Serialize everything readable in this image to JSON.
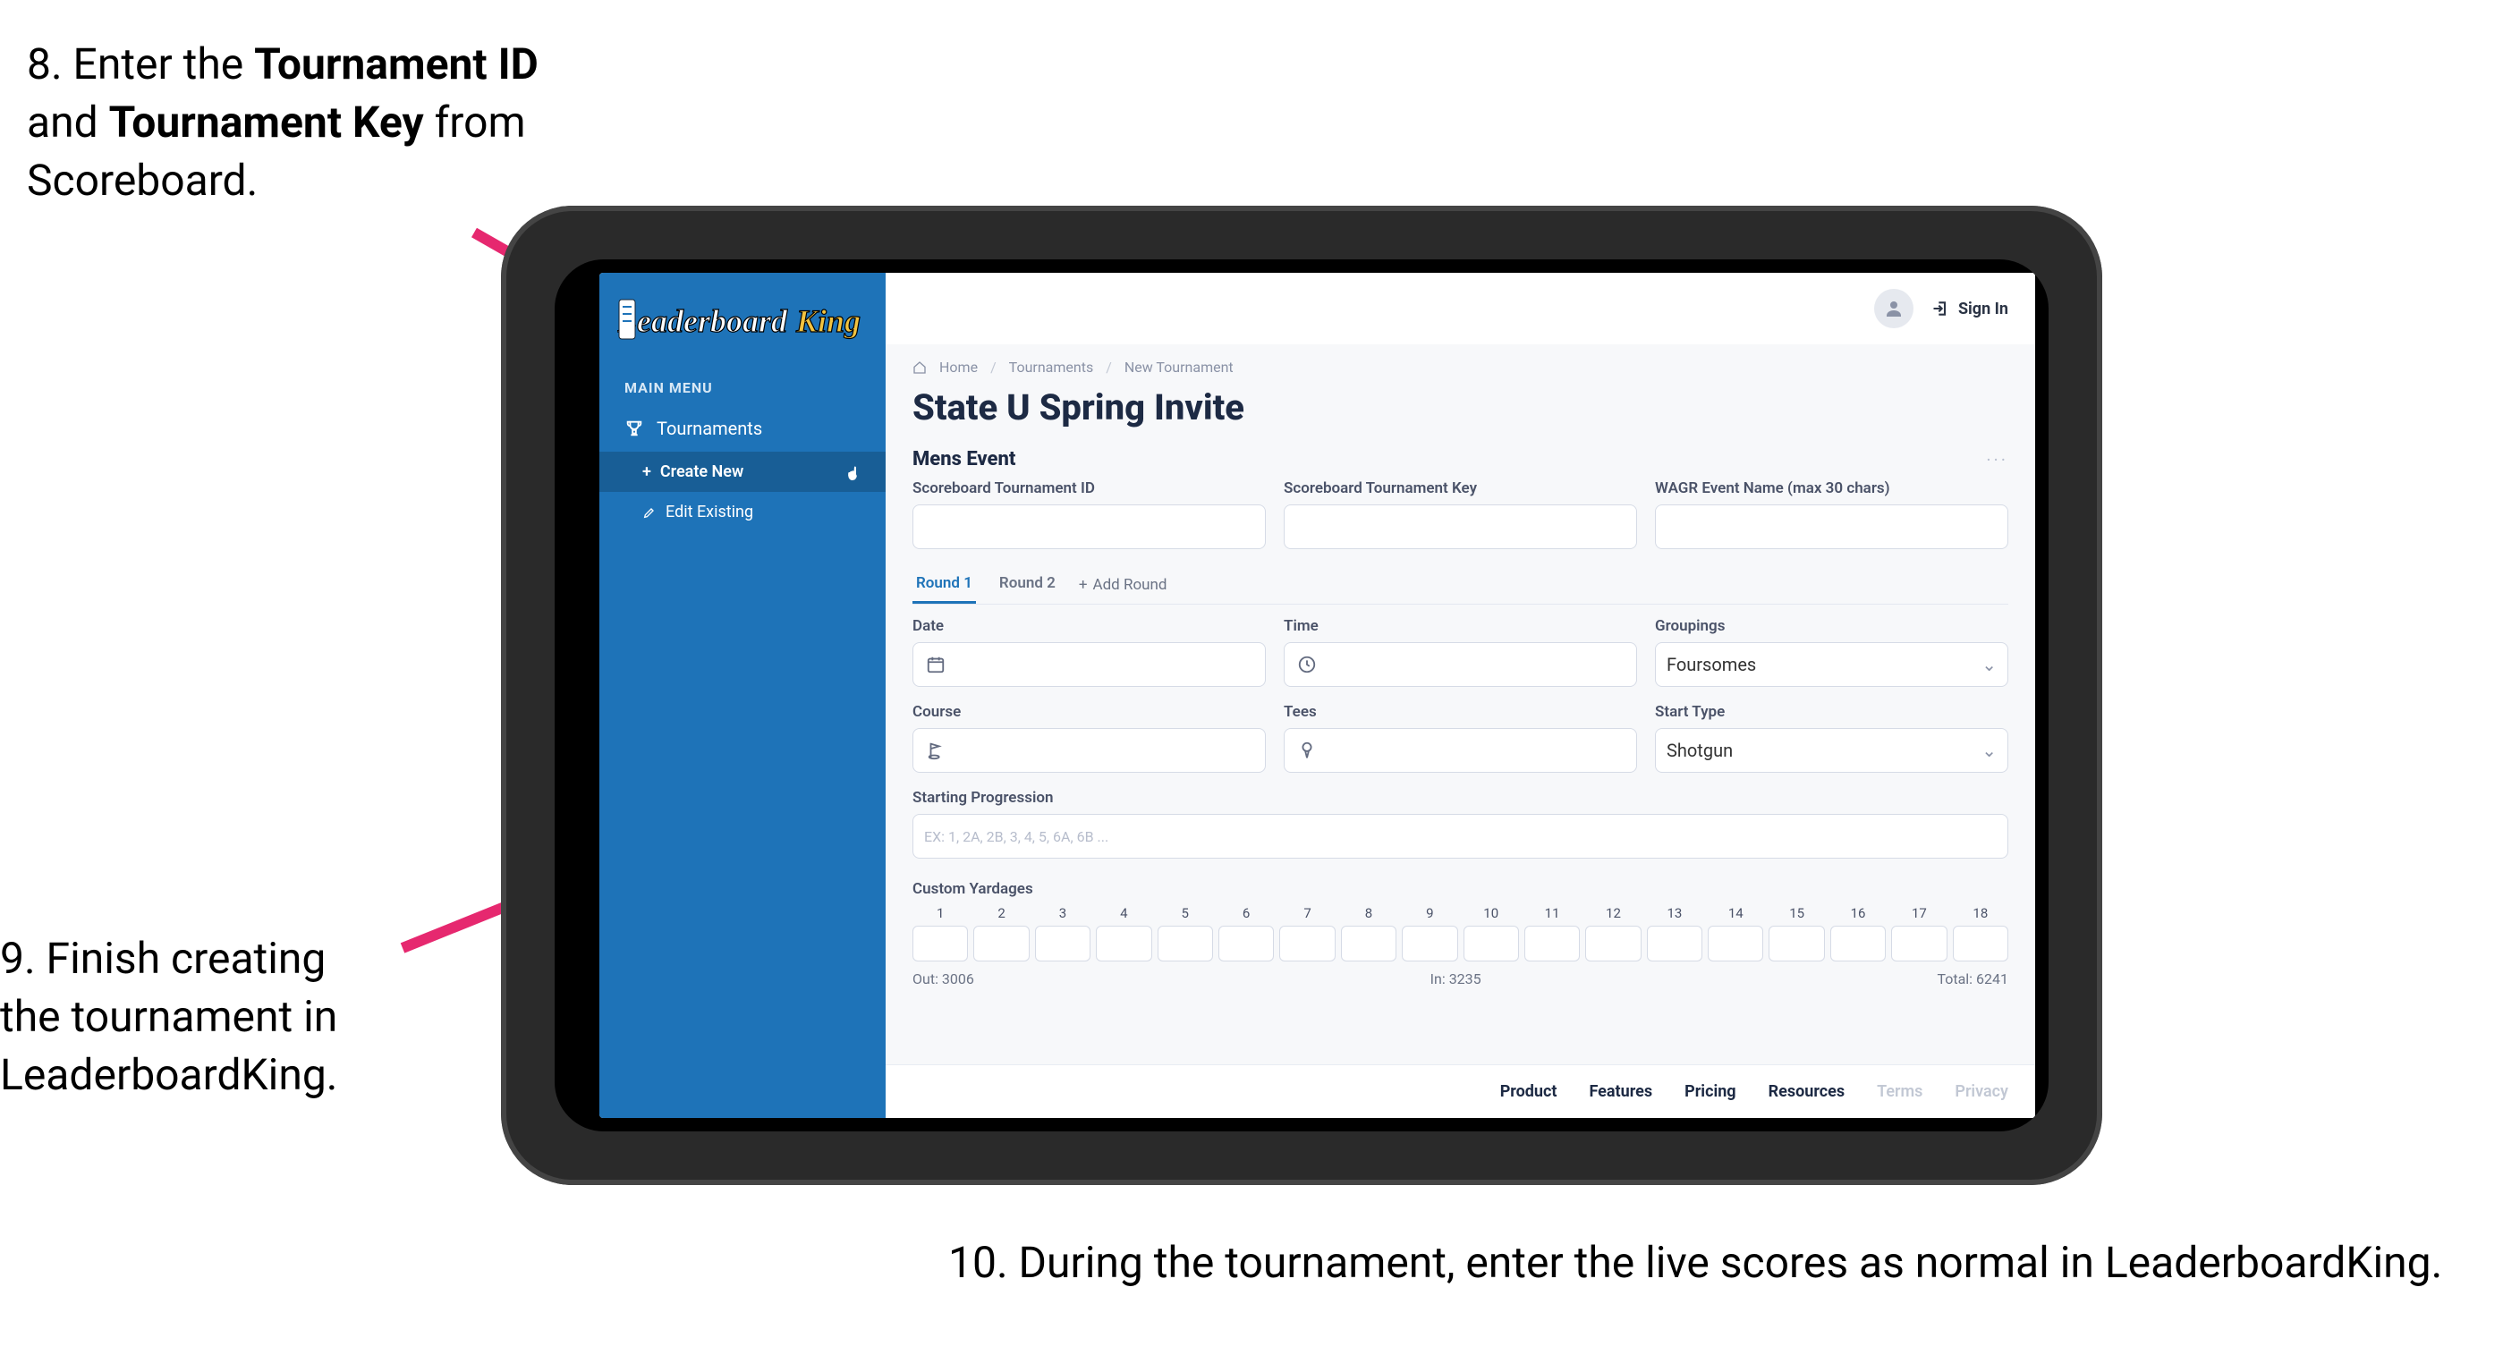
{
  "annotations": {
    "step8_pre": "8. Enter the ",
    "step8_b1": "Tournament ID",
    "step8_mid": " and ",
    "step8_b2": "Tournament Key",
    "step8_post": " from Scoreboard.",
    "step9": "9. Finish creating the tournament in LeaderboardKing.",
    "step10": "10. During the tournament, enter the live scores as normal in LeaderboardKing."
  },
  "sidebar": {
    "brand": "LeaderboardKing",
    "main_menu_label": "MAIN MENU",
    "nav_tournaments": "Tournaments",
    "nav_create_new": "Create New",
    "nav_edit_existing": "Edit Existing"
  },
  "topbar": {
    "signin": "Sign In"
  },
  "breadcrumb": {
    "home": "Home",
    "tournaments": "Tournaments",
    "current": "New Tournament"
  },
  "page_title": "State U Spring Invite",
  "section_title": "Mens Event",
  "fields": {
    "scoreboard_id_label": "Scoreboard Tournament ID",
    "scoreboard_key_label": "Scoreboard Tournament Key",
    "wagr_label": "WAGR Event Name (max 30 chars)",
    "date_label": "Date",
    "time_label": "Time",
    "groupings_label": "Groupings",
    "groupings_value": "Foursomes",
    "course_label": "Course",
    "tees_label": "Tees",
    "start_type_label": "Start Type",
    "start_type_value": "Shotgun",
    "starting_progression_label": "Starting Progression",
    "starting_progression_placeholder": "EX: 1, 2A, 2B, 3, 4, 5, 6A, 6B ...",
    "custom_yardages_label": "Custom Yardages"
  },
  "tabs": {
    "round1": "Round 1",
    "round2": "Round 2",
    "add_round": "Add Round"
  },
  "holes": [
    "1",
    "2",
    "3",
    "4",
    "5",
    "6",
    "7",
    "8",
    "9",
    "10",
    "11",
    "12",
    "13",
    "14",
    "15",
    "16",
    "17",
    "18"
  ],
  "yardage_summary": {
    "out": "Out: 3006",
    "in": "In: 3235",
    "total": "Total: 6241"
  },
  "footer": {
    "product": "Product",
    "features": "Features",
    "pricing": "Pricing",
    "resources": "Resources",
    "terms": "Terms",
    "privacy": "Privacy"
  },
  "colors": {
    "arrow": "#e6286f",
    "sidebar": "#1e73b8"
  }
}
